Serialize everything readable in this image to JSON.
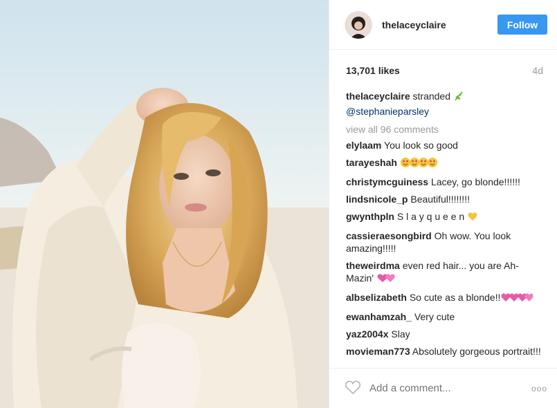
{
  "post": {
    "username": "thelaceyclaire",
    "follow_label": "Follow",
    "likes": "13,701 likes",
    "age": "4d"
  },
  "caption": {
    "user": "thelaceyclaire",
    "text": "stranded",
    "mention": "@stephanieparsley"
  },
  "view_all": "view all 96 comments",
  "comments": [
    {
      "user": "elylaam",
      "text": "You look so good"
    },
    {
      "user": "tarayeshah",
      "text": ""
    },
    {
      "user": "christymcguiness",
      "text": "Lacey, go blonde!!!!!!"
    },
    {
      "user": "lindsnicole_p",
      "text": "Beautiful!!!!!!!!"
    },
    {
      "user": "gwynthpln",
      "text": "S l a y q u e e n"
    },
    {
      "user": "cassieraesongbird",
      "text": "Oh wow. You look amazing!!!!!"
    },
    {
      "user": "theweirdma",
      "text": "even red hair... you are Ah-Mazin'"
    },
    {
      "user": "albselizabeth",
      "text": "So cute as a blonde!!"
    },
    {
      "user": "ewanhamzah_",
      "text": "Very cute"
    },
    {
      "user": "yaz2004x",
      "text": "Slay"
    },
    {
      "user": "movieman773",
      "text": "Absolutely gorgeous portrait!!!"
    }
  ],
  "footer": {
    "placeholder": "Add a comment...",
    "more": "ooo"
  },
  "icons": {
    "like": "heart-outline-icon",
    "options": "more-options-icon",
    "caption_emoji": "herb-emoji",
    "heart_eyes": "heart-eyes-emoji",
    "yellow_heart": "yellow-heart-emoji",
    "sparkling_heart": "sparkling-heart-emoji"
  },
  "colors": {
    "follow": "#3897f0",
    "mention": "#003569",
    "muted": "#999999"
  }
}
